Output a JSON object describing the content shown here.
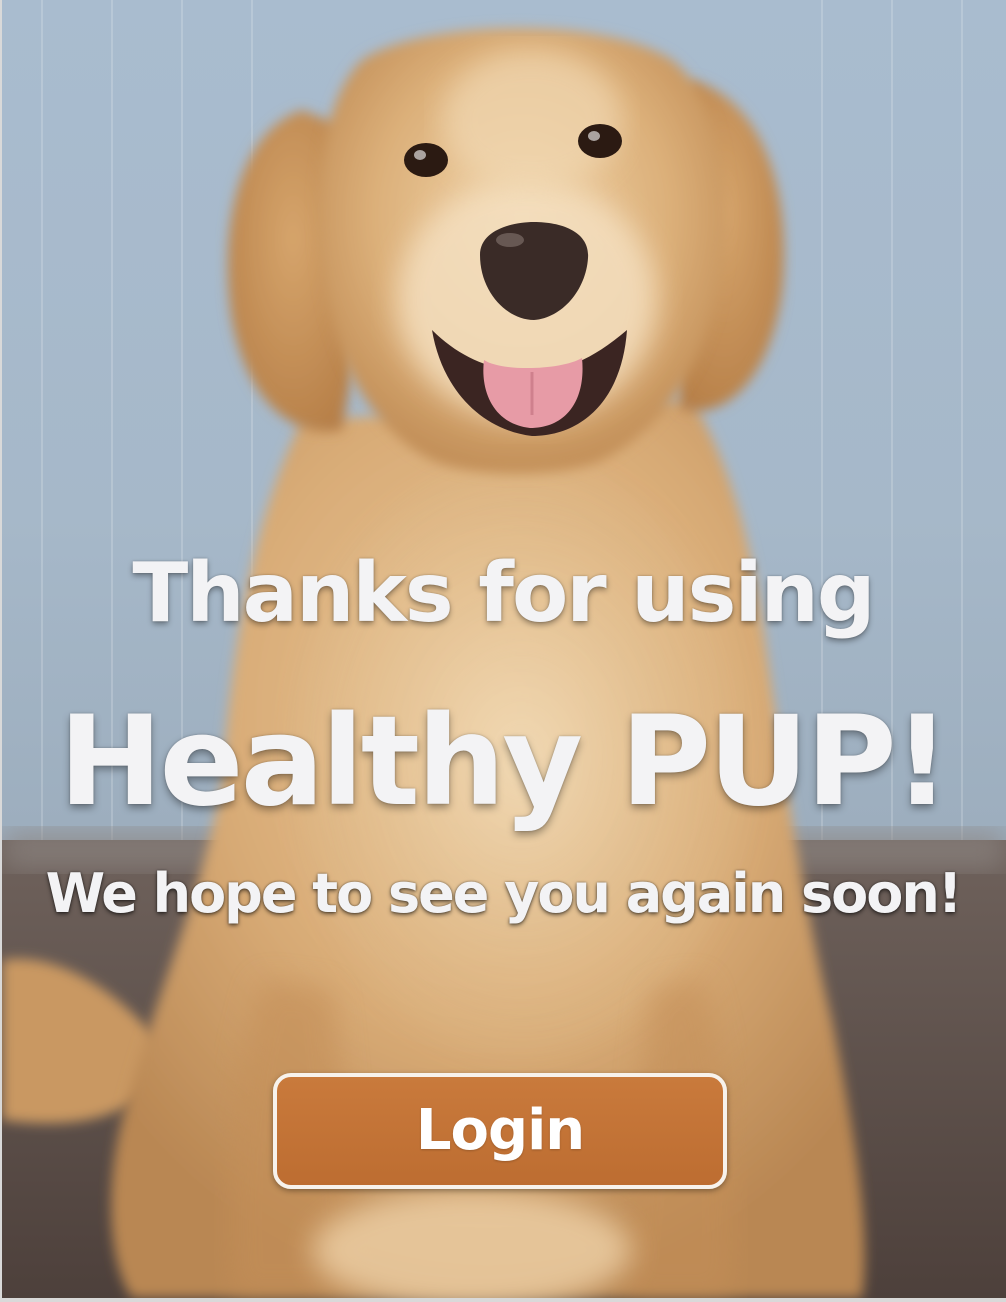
{
  "screen": {
    "line_1": "Thanks for using",
    "line_2": "Healthy PUP!",
    "line_3": "We hope to see you again soon!"
  },
  "actions": {
    "login_label": "Login"
  },
  "background": {
    "subject": "golden retriever photo"
  },
  "colors": {
    "button": "#c27236",
    "text": "#f3f3f5",
    "wall": "#a8bccf"
  }
}
